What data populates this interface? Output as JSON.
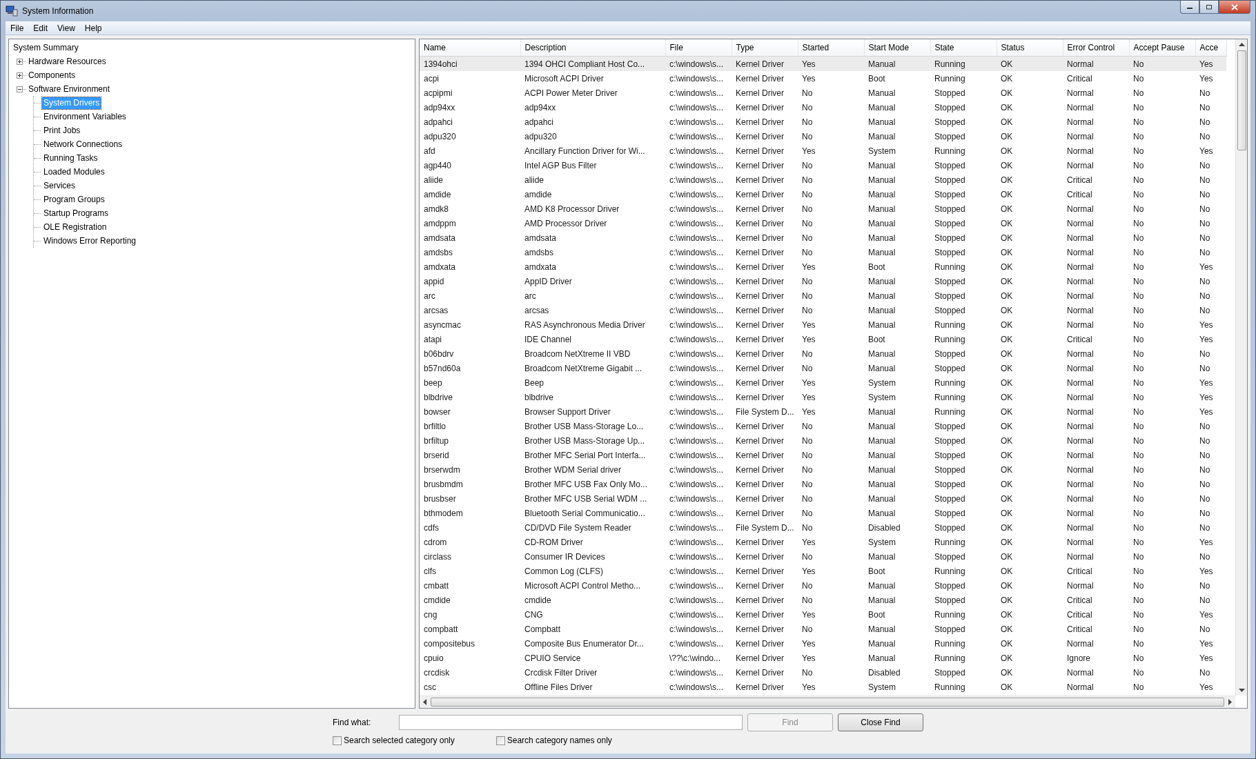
{
  "window": {
    "title": "System Information"
  },
  "menu": [
    "File",
    "Edit",
    "View",
    "Help"
  ],
  "tree": {
    "label": "System Summary",
    "selected": false,
    "children": [
      {
        "label": "Hardware Resources",
        "selected": false,
        "expanded": false
      },
      {
        "label": "Components",
        "selected": false,
        "expanded": false
      },
      {
        "label": "Software Environment",
        "selected": false,
        "expanded": true,
        "children": [
          {
            "label": "System Drivers",
            "selected": true
          },
          {
            "label": "Environment Variables",
            "selected": false
          },
          {
            "label": "Print Jobs",
            "selected": false
          },
          {
            "label": "Network Connections",
            "selected": false
          },
          {
            "label": "Running Tasks",
            "selected": false
          },
          {
            "label": "Loaded Modules",
            "selected": false
          },
          {
            "label": "Services",
            "selected": false
          },
          {
            "label": "Program Groups",
            "selected": false
          },
          {
            "label": "Startup Programs",
            "selected": false
          },
          {
            "label": "OLE Registration",
            "selected": false
          },
          {
            "label": "Windows Error Reporting",
            "selected": false
          }
        ]
      }
    ]
  },
  "table": {
    "columns": [
      "Name",
      "Description",
      "File",
      "Type",
      "Started",
      "Start Mode",
      "State",
      "Status",
      "Error Control",
      "Accept Pause",
      "Acce"
    ],
    "rows": [
      {
        "selected": true,
        "cells": [
          "1394ohci",
          "1394 OHCI Compliant Host Co...",
          "c:\\windows\\s...",
          "Kernel Driver",
          "Yes",
          "Manual",
          "Running",
          "OK",
          "Normal",
          "No",
          "Yes"
        ]
      },
      {
        "selected": false,
        "cells": [
          "acpi",
          "Microsoft ACPI Driver",
          "c:\\windows\\s...",
          "Kernel Driver",
          "Yes",
          "Boot",
          "Running",
          "OK",
          "Critical",
          "No",
          "Yes"
        ]
      },
      {
        "selected": false,
        "cells": [
          "acpipmi",
          "ACPI Power Meter Driver",
          "c:\\windows\\s...",
          "Kernel Driver",
          "No",
          "Manual",
          "Stopped",
          "OK",
          "Normal",
          "No",
          "No"
        ]
      },
      {
        "selected": false,
        "cells": [
          "adp94xx",
          "adp94xx",
          "c:\\windows\\s...",
          "Kernel Driver",
          "No",
          "Manual",
          "Stopped",
          "OK",
          "Normal",
          "No",
          "No"
        ]
      },
      {
        "selected": false,
        "cells": [
          "adpahci",
          "adpahci",
          "c:\\windows\\s...",
          "Kernel Driver",
          "No",
          "Manual",
          "Stopped",
          "OK",
          "Normal",
          "No",
          "No"
        ]
      },
      {
        "selected": false,
        "cells": [
          "adpu320",
          "adpu320",
          "c:\\windows\\s...",
          "Kernel Driver",
          "No",
          "Manual",
          "Stopped",
          "OK",
          "Normal",
          "No",
          "No"
        ]
      },
      {
        "selected": false,
        "cells": [
          "afd",
          "Ancillary Function Driver for Wi...",
          "c:\\windows\\s...",
          "Kernel Driver",
          "Yes",
          "System",
          "Running",
          "OK",
          "Normal",
          "No",
          "Yes"
        ]
      },
      {
        "selected": false,
        "cells": [
          "agp440",
          "Intel AGP Bus Filter",
          "c:\\windows\\s...",
          "Kernel Driver",
          "No",
          "Manual",
          "Stopped",
          "OK",
          "Normal",
          "No",
          "No"
        ]
      },
      {
        "selected": false,
        "cells": [
          "aliide",
          "aliide",
          "c:\\windows\\s...",
          "Kernel Driver",
          "No",
          "Manual",
          "Stopped",
          "OK",
          "Critical",
          "No",
          "No"
        ]
      },
      {
        "selected": false,
        "cells": [
          "amdide",
          "amdide",
          "c:\\windows\\s...",
          "Kernel Driver",
          "No",
          "Manual",
          "Stopped",
          "OK",
          "Critical",
          "No",
          "No"
        ]
      },
      {
        "selected": false,
        "cells": [
          "amdk8",
          "AMD K8 Processor Driver",
          "c:\\windows\\s...",
          "Kernel Driver",
          "No",
          "Manual",
          "Stopped",
          "OK",
          "Normal",
          "No",
          "No"
        ]
      },
      {
        "selected": false,
        "cells": [
          "amdppm",
          "AMD Processor Driver",
          "c:\\windows\\s...",
          "Kernel Driver",
          "No",
          "Manual",
          "Stopped",
          "OK",
          "Normal",
          "No",
          "No"
        ]
      },
      {
        "selected": false,
        "cells": [
          "amdsata",
          "amdsata",
          "c:\\windows\\s...",
          "Kernel Driver",
          "No",
          "Manual",
          "Stopped",
          "OK",
          "Normal",
          "No",
          "No"
        ]
      },
      {
        "selected": false,
        "cells": [
          "amdsbs",
          "amdsbs",
          "c:\\windows\\s...",
          "Kernel Driver",
          "No",
          "Manual",
          "Stopped",
          "OK",
          "Normal",
          "No",
          "No"
        ]
      },
      {
        "selected": false,
        "cells": [
          "amdxata",
          "amdxata",
          "c:\\windows\\s...",
          "Kernel Driver",
          "Yes",
          "Boot",
          "Running",
          "OK",
          "Normal",
          "No",
          "Yes"
        ]
      },
      {
        "selected": false,
        "cells": [
          "appid",
          "AppID Driver",
          "c:\\windows\\s...",
          "Kernel Driver",
          "No",
          "Manual",
          "Stopped",
          "OK",
          "Normal",
          "No",
          "No"
        ]
      },
      {
        "selected": false,
        "cells": [
          "arc",
          "arc",
          "c:\\windows\\s...",
          "Kernel Driver",
          "No",
          "Manual",
          "Stopped",
          "OK",
          "Normal",
          "No",
          "No"
        ]
      },
      {
        "selected": false,
        "cells": [
          "arcsas",
          "arcsas",
          "c:\\windows\\s...",
          "Kernel Driver",
          "No",
          "Manual",
          "Stopped",
          "OK",
          "Normal",
          "No",
          "No"
        ]
      },
      {
        "selected": false,
        "cells": [
          "asyncmac",
          "RAS Asynchronous Media Driver",
          "c:\\windows\\s...",
          "Kernel Driver",
          "Yes",
          "Manual",
          "Running",
          "OK",
          "Normal",
          "No",
          "Yes"
        ]
      },
      {
        "selected": false,
        "cells": [
          "atapi",
          "IDE Channel",
          "c:\\windows\\s...",
          "Kernel Driver",
          "Yes",
          "Boot",
          "Running",
          "OK",
          "Critical",
          "No",
          "Yes"
        ]
      },
      {
        "selected": false,
        "cells": [
          "b06bdrv",
          "Broadcom NetXtreme II VBD",
          "c:\\windows\\s...",
          "Kernel Driver",
          "No",
          "Manual",
          "Stopped",
          "OK",
          "Normal",
          "No",
          "No"
        ]
      },
      {
        "selected": false,
        "cells": [
          "b57nd60a",
          "Broadcom NetXtreme Gigabit ...",
          "c:\\windows\\s...",
          "Kernel Driver",
          "No",
          "Manual",
          "Stopped",
          "OK",
          "Normal",
          "No",
          "No"
        ]
      },
      {
        "selected": false,
        "cells": [
          "beep",
          "Beep",
          "c:\\windows\\s...",
          "Kernel Driver",
          "Yes",
          "System",
          "Running",
          "OK",
          "Normal",
          "No",
          "Yes"
        ]
      },
      {
        "selected": false,
        "cells": [
          "blbdrive",
          "blbdrive",
          "c:\\windows\\s...",
          "Kernel Driver",
          "Yes",
          "System",
          "Running",
          "OK",
          "Normal",
          "No",
          "Yes"
        ]
      },
      {
        "selected": false,
        "cells": [
          "bowser",
          "Browser Support Driver",
          "c:\\windows\\s...",
          "File System D...",
          "Yes",
          "Manual",
          "Running",
          "OK",
          "Normal",
          "No",
          "Yes"
        ]
      },
      {
        "selected": false,
        "cells": [
          "brfiltlo",
          "Brother USB Mass-Storage Lo...",
          "c:\\windows\\s...",
          "Kernel Driver",
          "No",
          "Manual",
          "Stopped",
          "OK",
          "Normal",
          "No",
          "No"
        ]
      },
      {
        "selected": false,
        "cells": [
          "brfiltup",
          "Brother USB Mass-Storage Up...",
          "c:\\windows\\s...",
          "Kernel Driver",
          "No",
          "Manual",
          "Stopped",
          "OK",
          "Normal",
          "No",
          "No"
        ]
      },
      {
        "selected": false,
        "cells": [
          "brserid",
          "Brother MFC Serial Port Interfa...",
          "c:\\windows\\s...",
          "Kernel Driver",
          "No",
          "Manual",
          "Stopped",
          "OK",
          "Normal",
          "No",
          "No"
        ]
      },
      {
        "selected": false,
        "cells": [
          "brserwdm",
          "Brother WDM Serial driver",
          "c:\\windows\\s...",
          "Kernel Driver",
          "No",
          "Manual",
          "Stopped",
          "OK",
          "Normal",
          "No",
          "No"
        ]
      },
      {
        "selected": false,
        "cells": [
          "brusbmdm",
          "Brother MFC USB Fax Only Mo...",
          "c:\\windows\\s...",
          "Kernel Driver",
          "No",
          "Manual",
          "Stopped",
          "OK",
          "Normal",
          "No",
          "No"
        ]
      },
      {
        "selected": false,
        "cells": [
          "brusbser",
          "Brother MFC USB Serial WDM ...",
          "c:\\windows\\s...",
          "Kernel Driver",
          "No",
          "Manual",
          "Stopped",
          "OK",
          "Normal",
          "No",
          "No"
        ]
      },
      {
        "selected": false,
        "cells": [
          "bthmodem",
          "Bluetooth Serial Communicatio...",
          "c:\\windows\\s...",
          "Kernel Driver",
          "No",
          "Manual",
          "Stopped",
          "OK",
          "Normal",
          "No",
          "No"
        ]
      },
      {
        "selected": false,
        "cells": [
          "cdfs",
          "CD/DVD File System Reader",
          "c:\\windows\\s...",
          "File System D...",
          "No",
          "Disabled",
          "Stopped",
          "OK",
          "Normal",
          "No",
          "No"
        ]
      },
      {
        "selected": false,
        "cells": [
          "cdrom",
          "CD-ROM Driver",
          "c:\\windows\\s...",
          "Kernel Driver",
          "Yes",
          "System",
          "Running",
          "OK",
          "Normal",
          "No",
          "Yes"
        ]
      },
      {
        "selected": false,
        "cells": [
          "circlass",
          "Consumer IR Devices",
          "c:\\windows\\s...",
          "Kernel Driver",
          "No",
          "Manual",
          "Stopped",
          "OK",
          "Normal",
          "No",
          "No"
        ]
      },
      {
        "selected": false,
        "cells": [
          "clfs",
          "Common Log (CLFS)",
          "c:\\windows\\s...",
          "Kernel Driver",
          "Yes",
          "Boot",
          "Running",
          "OK",
          "Critical",
          "No",
          "Yes"
        ]
      },
      {
        "selected": false,
        "cells": [
          "cmbatt",
          "Microsoft ACPI Control Metho...",
          "c:\\windows\\s...",
          "Kernel Driver",
          "No",
          "Manual",
          "Stopped",
          "OK",
          "Normal",
          "No",
          "No"
        ]
      },
      {
        "selected": false,
        "cells": [
          "cmdide",
          "cmdide",
          "c:\\windows\\s...",
          "Kernel Driver",
          "No",
          "Manual",
          "Stopped",
          "OK",
          "Critical",
          "No",
          "No"
        ]
      },
      {
        "selected": false,
        "cells": [
          "cng",
          "CNG",
          "c:\\windows\\s...",
          "Kernel Driver",
          "Yes",
          "Boot",
          "Running",
          "OK",
          "Critical",
          "No",
          "Yes"
        ]
      },
      {
        "selected": false,
        "cells": [
          "compbatt",
          "Compbatt",
          "c:\\windows\\s...",
          "Kernel Driver",
          "No",
          "Manual",
          "Stopped",
          "OK",
          "Critical",
          "No",
          "No"
        ]
      },
      {
        "selected": false,
        "cells": [
          "compositebus",
          "Composite Bus Enumerator Dr...",
          "c:\\windows\\s...",
          "Kernel Driver",
          "Yes",
          "Manual",
          "Running",
          "OK",
          "Normal",
          "No",
          "Yes"
        ]
      },
      {
        "selected": false,
        "cells": [
          "cpuio",
          "CPUIO Service",
          "\\??\\c:\\windo...",
          "Kernel Driver",
          "Yes",
          "Manual",
          "Running",
          "OK",
          "Ignore",
          "No",
          "Yes"
        ]
      },
      {
        "selected": false,
        "cells": [
          "crcdisk",
          "Crcdisk Filter Driver",
          "c:\\windows\\s...",
          "Kernel Driver",
          "No",
          "Disabled",
          "Stopped",
          "OK",
          "Normal",
          "No",
          "No"
        ]
      },
      {
        "selected": false,
        "cells": [
          "csc",
          "Offline Files Driver",
          "c:\\windows\\s...",
          "Kernel Driver",
          "Yes",
          "System",
          "Running",
          "OK",
          "Normal",
          "No",
          "Yes"
        ]
      }
    ]
  },
  "find_bar": {
    "label": "Find what:",
    "find_button": {
      "label": "Find",
      "disabled": true
    },
    "close_button": "Close Find",
    "options": [
      {
        "label": "Search selected category only",
        "checked": false
      },
      {
        "label": "Search category names only",
        "checked": false
      }
    ]
  }
}
